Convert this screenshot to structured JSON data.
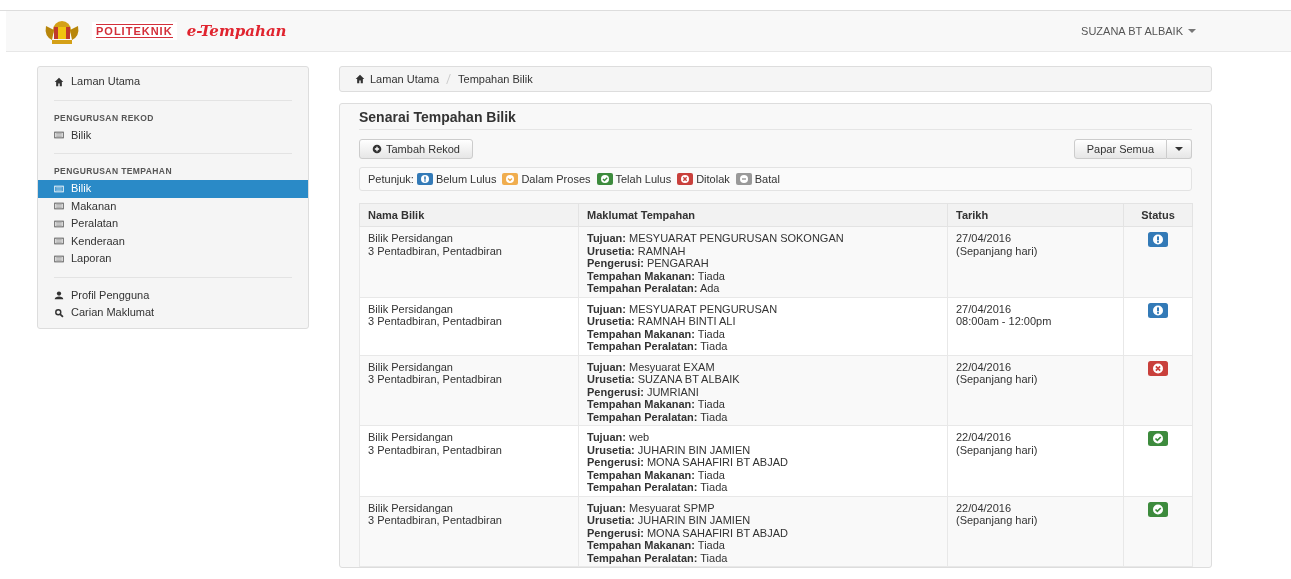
{
  "navbar": {
    "logo_text": "POLITEKNIK",
    "title": "e-Tempahan",
    "user": "SUZANA BT ALBAIK"
  },
  "sidebar": {
    "sections": [
      {
        "items": [
          {
            "label": "Laman Utama",
            "selected": false
          }
        ]
      },
      {
        "heading": "PENGURUSAN REKOD",
        "items": [
          {
            "label": "Bilik",
            "selected": false
          }
        ]
      },
      {
        "heading": "PENGURUSAN TEMPAHAN",
        "items": [
          {
            "label": "Bilik",
            "selected": true
          },
          {
            "label": "Makanan",
            "selected": false
          },
          {
            "label": "Peralatan",
            "selected": false
          },
          {
            "label": "Kenderaan",
            "selected": false
          },
          {
            "label": "Laporan",
            "selected": false
          }
        ]
      },
      {
        "items": [
          {
            "label": "Profil Pengguna",
            "selected": false
          },
          {
            "label": "Carian Maklumat",
            "selected": false
          }
        ]
      }
    ]
  },
  "breadcrumb": [
    "Laman Utama",
    "Tempahan Bilik"
  ],
  "panel": {
    "title": "Senarai Tempahan Bilik",
    "add_button": "Tambah Rekod",
    "view_button": "Papar Semua",
    "legend": {
      "label": "Petunjuk:",
      "items": [
        {
          "kind": "pending",
          "label": "Belum Lulus",
          "color": "#337ab7"
        },
        {
          "kind": "process",
          "label": "Dalam Proses",
          "color": "#f0ad4e"
        },
        {
          "kind": "approved",
          "label": "Telah Lulus",
          "color": "#3d8b3d"
        },
        {
          "kind": "rejected",
          "label": "Ditolak",
          "color": "#c9403c"
        },
        {
          "kind": "cancelled",
          "label": "Batal",
          "color": "#999999"
        }
      ]
    },
    "table": {
      "columns": [
        "Nama Bilik",
        "Maklumat Tempahan",
        "Tarikh",
        "Status"
      ],
      "rows": [
        {
          "room": [
            "Bilik Persidangan",
            "3 Pentadbiran, Pentadbiran"
          ],
          "details": [
            {
              "label": "Tujuan:",
              "value": "MESYUARAT PENGURUSAN SOKONGAN"
            },
            {
              "label": "Urusetia:",
              "value": "RAMNAH"
            },
            {
              "label": "Pengerusi:",
              "value": "PENGARAH"
            },
            {
              "label": "Tempahan Makanan:",
              "value": "Tiada"
            },
            {
              "label": "Tempahan Peralatan:",
              "value": "Ada"
            }
          ],
          "date": [
            "27/04/2016",
            "(Sepanjang hari)"
          ],
          "kind": "pending"
        },
        {
          "room": [
            "Bilik Persidangan",
            "3 Pentadbiran, Pentadbiran"
          ],
          "details": [
            {
              "label": "Tujuan:",
              "value": "MESYUARAT PENGURUSAN"
            },
            {
              "label": "Urusetia:",
              "value": "RAMNAH BINTI ALI"
            },
            {
              "label": "Tempahan Makanan:",
              "value": "Tiada"
            },
            {
              "label": "Tempahan Peralatan:",
              "value": "Tiada"
            }
          ],
          "date": [
            "27/04/2016",
            "08:00am - 12:00pm"
          ],
          "kind": "pending"
        },
        {
          "room": [
            "Bilik Persidangan",
            "3 Pentadbiran, Pentadbiran"
          ],
          "details": [
            {
              "label": "Tujuan:",
              "value": "Mesyuarat EXAM"
            },
            {
              "label": "Urusetia:",
              "value": "SUZANA BT ALBAIK"
            },
            {
              "label": "Pengerusi:",
              "value": "JUMRIANI"
            },
            {
              "label": "Tempahan Makanan:",
              "value": "Tiada"
            },
            {
              "label": "Tempahan Peralatan:",
              "value": "Tiada"
            }
          ],
          "date": [
            "22/04/2016",
            "(Sepanjang hari)"
          ],
          "kind": "rejected"
        },
        {
          "room": [
            "Bilik Persidangan",
            "3 Pentadbiran, Pentadbiran"
          ],
          "details": [
            {
              "label": "Tujuan:",
              "value": "web"
            },
            {
              "label": "Urusetia:",
              "value": "JUHARIN BIN JAMIEN"
            },
            {
              "label": "Pengerusi:",
              "value": "MONA SAHAFIRI BT ABJAD"
            },
            {
              "label": "Tempahan Makanan:",
              "value": "Tiada"
            },
            {
              "label": "Tempahan Peralatan:",
              "value": "Tiada"
            }
          ],
          "date": [
            "22/04/2016",
            "(Sepanjang hari)"
          ],
          "kind": "approved"
        },
        {
          "room": [
            "Bilik Persidangan",
            "3 Pentadbiran, Pentadbiran"
          ],
          "details": [
            {
              "label": "Tujuan:",
              "value": "Mesyuarat SPMP"
            },
            {
              "label": "Urusetia:",
              "value": "JUHARIN BIN JAMIEN"
            },
            {
              "label": "Pengerusi:",
              "value": "MONA SAHAFIRI BT ABJAD"
            },
            {
              "label": "Tempahan Makanan:",
              "value": "Tiada"
            },
            {
              "label": "Tempahan Peralatan:",
              "value": "Tiada"
            }
          ],
          "date": [
            "22/04/2016",
            "(Sepanjang hari)"
          ],
          "kind": "approved"
        }
      ]
    }
  }
}
